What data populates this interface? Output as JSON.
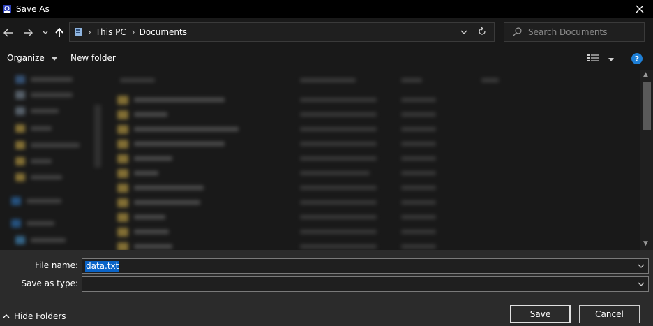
{
  "window": {
    "title": "Save As"
  },
  "address": {
    "crumbs": [
      "This PC",
      "Documents"
    ]
  },
  "search": {
    "placeholder": "Search Documents"
  },
  "toolbar": {
    "organize_label": "Organize",
    "new_folder_label": "New folder",
    "help_label": "?"
  },
  "form": {
    "file_name_label": "File name:",
    "file_name_value": "data.txt",
    "save_as_type_label": "Save as type:",
    "save_as_type_value": ""
  },
  "footer": {
    "hide_folders_label": "Hide Folders",
    "save_label": "Save",
    "cancel_label": "Cancel"
  },
  "colors": {
    "accent": "#0a64c8",
    "help": "#1e7fd6",
    "folder": "#d8b44a"
  }
}
